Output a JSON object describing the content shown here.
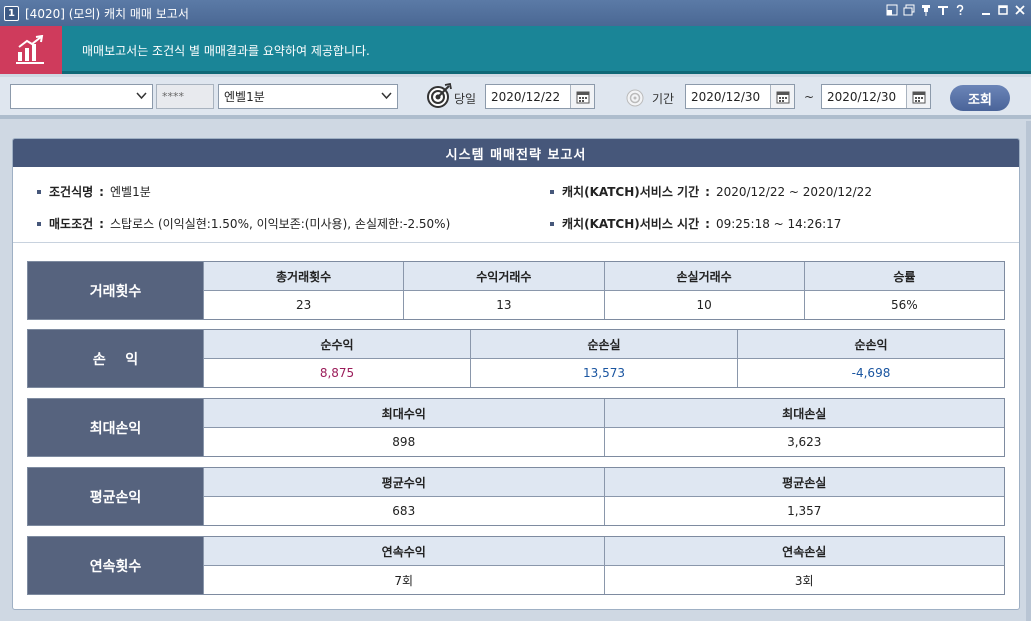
{
  "window": {
    "number": "1",
    "title": "[4020] (모의) 캐치 매매 보고서"
  },
  "banner": {
    "icon": "report-chart-icon",
    "text": "매매보고서는 조건식 별 매매결과를 요약하여 제공합니다."
  },
  "toolbar": {
    "account_value": "",
    "password_mask": "****",
    "condition_value": "엔벨1분",
    "today_label": "당일",
    "today_date": "2020/12/22",
    "period_label": "기간",
    "period_from": "2020/12/30",
    "tilde": "~",
    "period_to": "2020/12/30",
    "query_label": "조회"
  },
  "report": {
    "title": "시스템 매매전략 보고서",
    "condition_name_label": "조건식명",
    "condition_name_value": "엔벨1분",
    "sell_condition_label": "매도조건",
    "sell_condition_value": "스탑로스 (이익실현:1.50%, 이익보존:(미사용), 손실제한:-2.50%)",
    "service_period_label": "캐치(KATCH)서비스 기간",
    "service_period_value": "2020/12/22 ~ 2020/12/22",
    "service_time_label": "캐치(KATCH)서비스 시간",
    "service_time_value": "09:25:18 ~ 14:26:17",
    "colon": ":"
  },
  "blocks": [
    {
      "head": "거래횟수",
      "cols": [
        {
          "h": "총거래횟수",
          "v": "23"
        },
        {
          "h": "수익거래수",
          "v": "13"
        },
        {
          "h": "손실거래수",
          "v": "10"
        },
        {
          "h": "승률",
          "v": "56%"
        }
      ]
    },
    {
      "head": "손    익",
      "cols": [
        {
          "h": "순수익",
          "v": "8,875"
        },
        {
          "h": "순손실",
          "v": "13,573"
        },
        {
          "h": "순손익",
          "v": "-4,698"
        }
      ]
    },
    {
      "head": "최대손익",
      "cols": [
        {
          "h": "최대수익",
          "v": "898"
        },
        {
          "h": "최대손실",
          "v": "3,623"
        }
      ]
    },
    {
      "head": "평균손익",
      "cols": [
        {
          "h": "평균수익",
          "v": "683"
        },
        {
          "h": "평균손실",
          "v": "1,357"
        }
      ]
    },
    {
      "head": "연속횟수",
      "cols": [
        {
          "h": "연속수익",
          "v": "7회"
        },
        {
          "h": "연속손실",
          "v": "3회"
        }
      ]
    }
  ],
  "colors": {
    "profit": "#9b1d5a",
    "loss": "#1a55a0",
    "net_negative": "#1a55a0"
  }
}
